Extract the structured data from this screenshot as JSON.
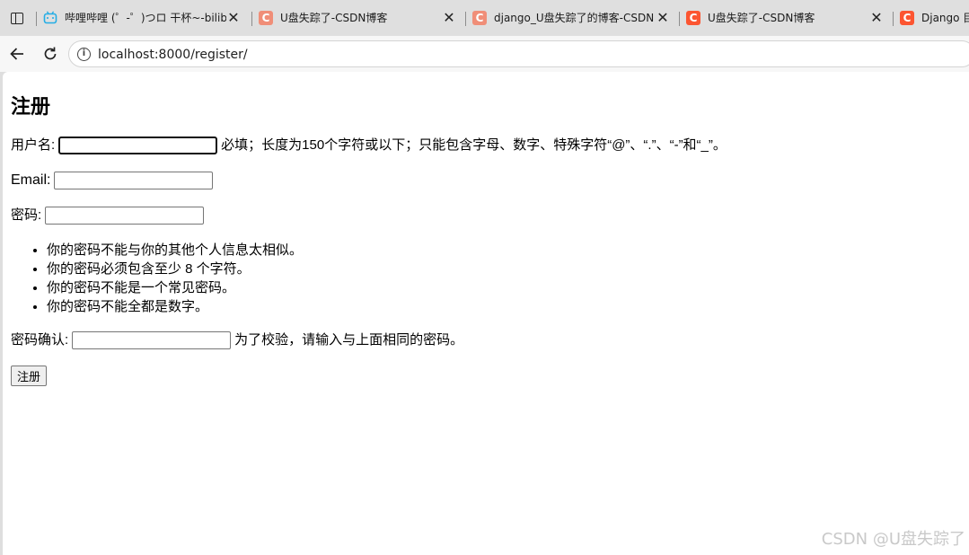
{
  "browser": {
    "tabs": [
      {
        "title": "哔哩哔哩 (゜-゜)つロ 干杯~-bilibili",
        "icon": "bilibili-icon"
      },
      {
        "title": "U盘失踪了-CSDN博客",
        "icon": "csdn-icon"
      },
      {
        "title": "django_U盘失踪了的博客-CSDN博",
        "icon": "csdn-icon"
      },
      {
        "title": "U盘失踪了-CSDN博客",
        "icon": "csdn-icon"
      },
      {
        "title": "Django 目录",
        "icon": "csdn-icon"
      }
    ],
    "favicon_letter": "C",
    "close_glyph": "✕",
    "url": "localhost:8000/register/",
    "accent": "#fc5531"
  },
  "form": {
    "heading": "注册",
    "username_label": "用户名:",
    "username_value": "",
    "username_help": "必填；长度为150个字符或以下；只能包含字母、数字、特殊字符“@”、“.”、“-”和“_”。",
    "email_label": "Email:",
    "email_value": "",
    "password_label": "密码:",
    "password_value": "",
    "password_rules": [
      "你的密码不能与你的其他个人信息太相似。",
      "你的密码必须包含至少 8 个字符。",
      "你的密码不能是一个常见密码。",
      "你的密码不能全都是数字。"
    ],
    "confirm_label": "密码确认:",
    "confirm_value": "",
    "confirm_help": "为了校验，请输入与上面相同的密码。",
    "submit_label": "注册"
  },
  "watermark": "CSDN @U盘失踪了"
}
